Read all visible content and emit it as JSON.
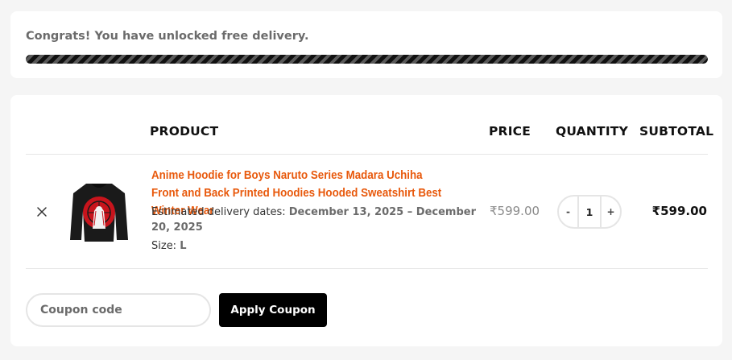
{
  "notice": {
    "text": "Congrats! You have unlocked free delivery.",
    "progress_fraction": 1.0
  },
  "cart": {
    "headers": {
      "product": "PRODUCT",
      "price": "PRICE",
      "quantity": "QUANTITY",
      "subtotal": "SUBTOTAL"
    },
    "items": [
      {
        "remove_icon": "close-icon",
        "title": "Anime Hoodie for Boys Naruto Series Madara Uchiha Front and Back Printed Hoodies Hooded Sweatshirt Best Winter Wear",
        "delivery_label": "Estimated delivery dates:",
        "delivery_dates": "December 13, 2025 – December 20, 2025",
        "size_label": "Size:",
        "size_value": "L",
        "price": "₹599.00",
        "quantity": "1",
        "minus_label": "-",
        "plus_label": "+",
        "subtotal": "₹599.00"
      }
    ],
    "coupon": {
      "placeholder": "Coupon code",
      "value": "",
      "button_label": "Apply Coupon"
    }
  },
  "colors": {
    "accent": "#e8590c",
    "button": "#000000",
    "background": "#f5f5f5"
  }
}
